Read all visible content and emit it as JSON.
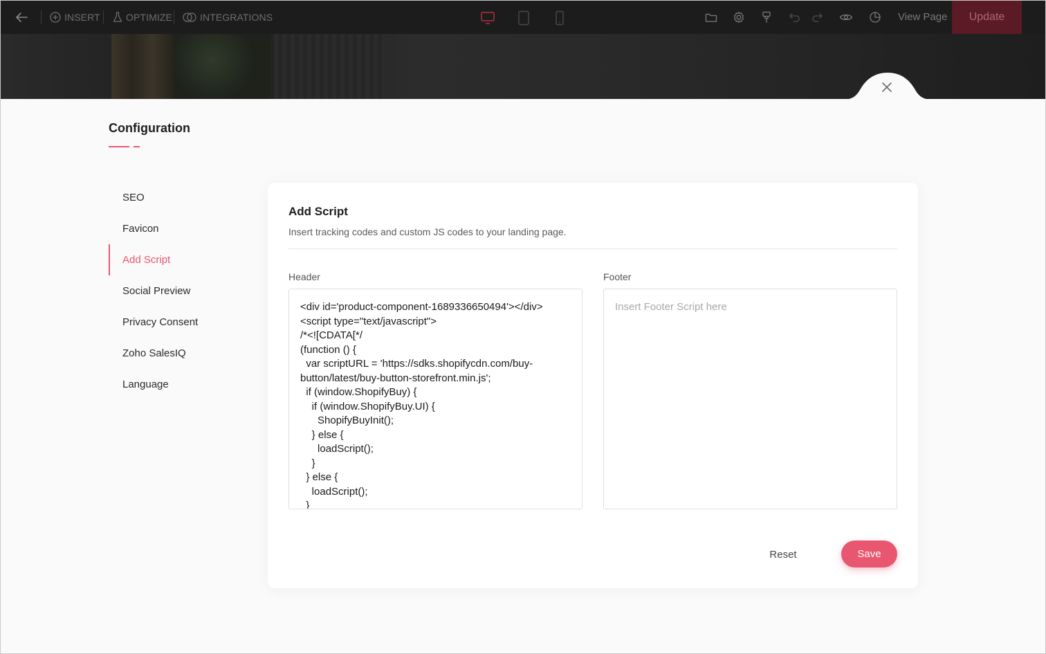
{
  "toolbar": {
    "back_icon": "arrow-left-icon",
    "insert_label": "INSERT",
    "optimize_label": "OPTIMIZE",
    "integrations_label": "INTEGRATIONS",
    "view_page_label": "View Page",
    "update_label": "Update",
    "devices": [
      "desktop-icon",
      "tablet-icon",
      "mobile-icon"
    ],
    "right_icons": [
      "folder-icon",
      "settings-icon",
      "paint-brush-icon",
      "undo-icon",
      "redo-icon",
      "eye-icon",
      "analytics-icon"
    ]
  },
  "config": {
    "title": "Configuration",
    "nav": [
      {
        "label": "SEO",
        "active": false
      },
      {
        "label": "Favicon",
        "active": false
      },
      {
        "label": "Add Script",
        "active": true
      },
      {
        "label": "Social Preview",
        "active": false
      },
      {
        "label": "Privacy Consent",
        "active": false
      },
      {
        "label": "Zoho SalesIQ",
        "active": false
      },
      {
        "label": "Language",
        "active": false
      }
    ]
  },
  "card": {
    "title": "Add Script",
    "subtitle": "Insert tracking codes and custom JS codes to your landing page.",
    "header_label": "Header",
    "footer_label": "Footer",
    "header_value": "<div id='product-component-1689336650494'></div>\n<script type=\"text/javascript\">\n/*<![CDATA[*/\n(function () {\n  var scriptURL = 'https://sdks.shopifycdn.com/buy-button/latest/buy-button-storefront.min.js';\n  if (window.ShopifyBuy) {\n    if (window.ShopifyBuy.UI) {\n      ShopifyBuyInit();\n    } else {\n      loadScript();\n    }\n  } else {\n    loadScript();\n  }",
    "footer_placeholder": "Insert Footer Script here",
    "reset_label": "Reset",
    "save_label": "Save"
  },
  "colors": {
    "accent": "#e8566f",
    "toolbar_bg": "#1c1c1c",
    "update_bg": "#5a1a26"
  }
}
